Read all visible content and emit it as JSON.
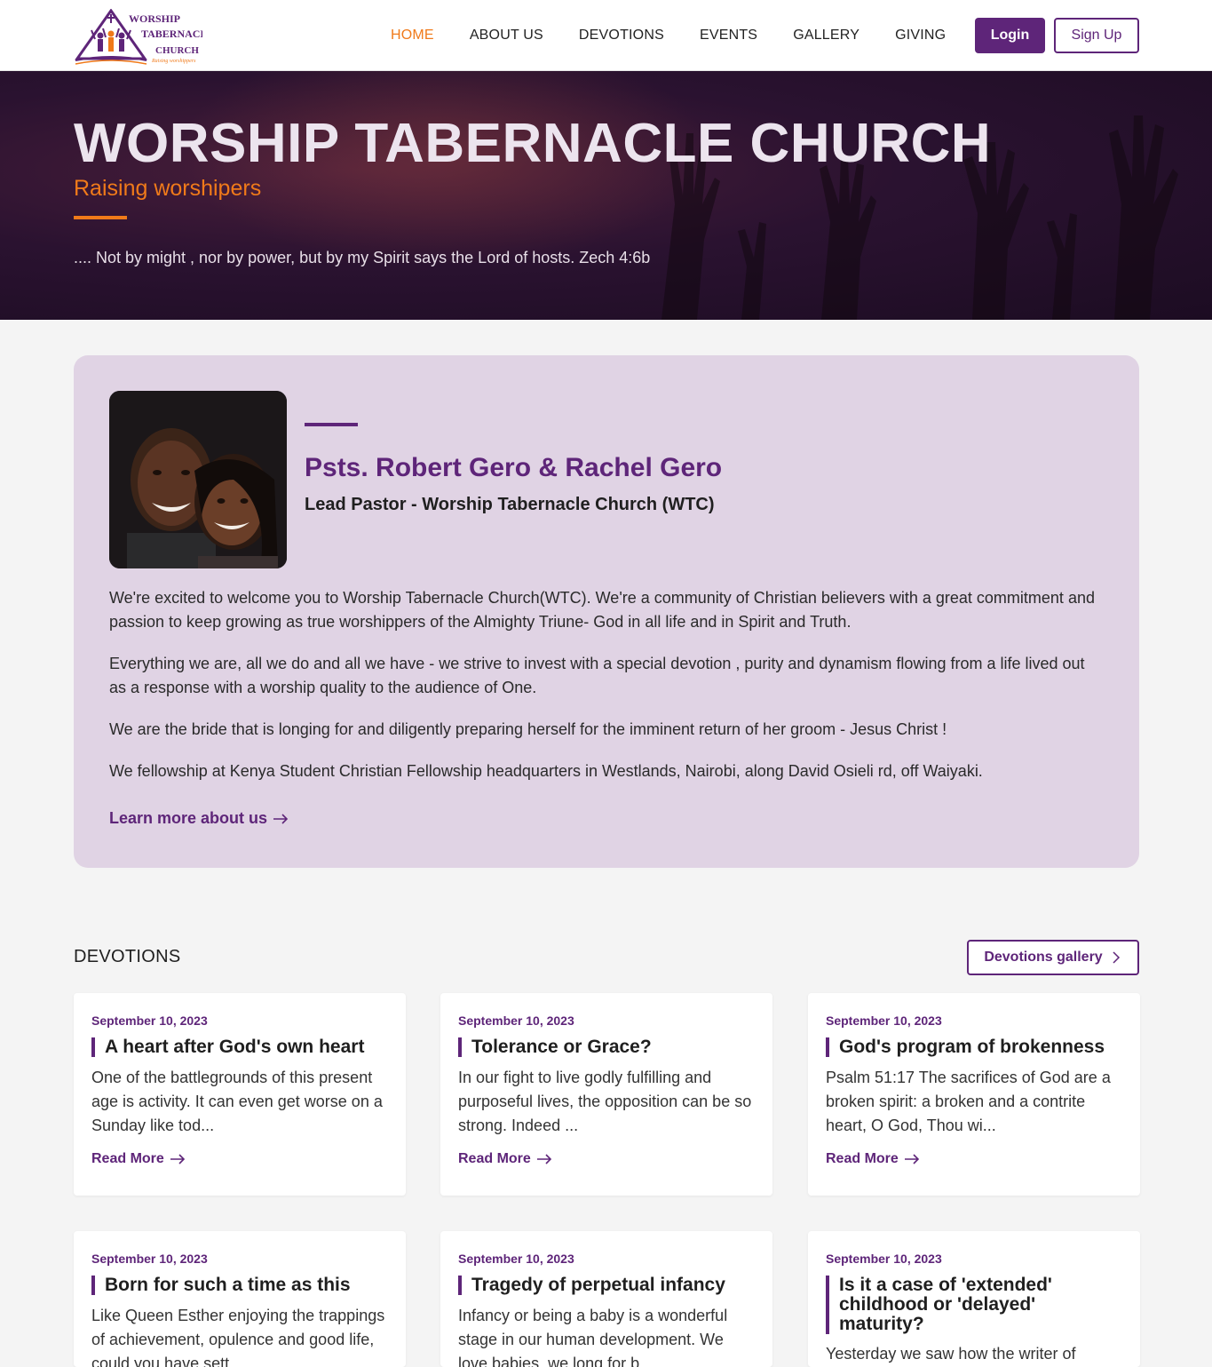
{
  "nav": {
    "logo_lines": [
      "WORSHIP",
      "TABERNACLE",
      "CHURCH"
    ],
    "logo_tagline": "Raising worshippers",
    "links": [
      "HOME",
      "ABOUT US",
      "DEVOTIONS",
      "EVENTS",
      "GALLERY",
      "GIVING"
    ],
    "active": "HOME",
    "login": "Login",
    "signup": "Sign Up"
  },
  "hero": {
    "title": "WORSHIP TABERNACLE CHURCH",
    "subtitle": "Raising worshipers",
    "verse": ".... Not by might , nor by power, but by my Spirit says the Lord of hosts. Zech 4:6b"
  },
  "pastor": {
    "name": "Psts. Robert Gero & Rachel Gero",
    "role": "Lead Pastor - Worship Tabernacle Church (WTC)",
    "paragraphs": [
      "We're excited to welcome you to Worship Tabernacle Church(WTC). We're a community of Christian believers with a great commitment and passion to keep growing as true worshippers of the Almighty Triune- God in all life and in Spirit and Truth.",
      "Everything we are, all we do and all we have - we strive to invest with a special devotion , purity and dynamism flowing from a life lived out as a response with a worship quality to the audience of One.",
      "We are the bride that is longing for and diligently preparing herself for the imminent return of her groom - Jesus Christ !",
      "We fellowship at Kenya Student Christian Fellowship headquarters in Westlands, Nairobi, along David Osieli rd, off Waiyaki."
    ],
    "learn_more": "Learn more about us"
  },
  "devotions": {
    "heading": "DEVOTIONS",
    "gallery_button": "Devotions gallery",
    "read_more": "Read More",
    "items": [
      {
        "date": "September 10, 2023",
        "title": "A heart after God's own heart",
        "excerpt": "One of the battlegrounds of this present age is activity. It can even get worse on a Sunday like tod..."
      },
      {
        "date": "September 10, 2023",
        "title": "Tolerance or Grace?",
        "excerpt": "In our fight to live godly fulfilling and purposeful lives, the opposition can be so strong. Indeed ..."
      },
      {
        "date": "September 10, 2023",
        "title": "God's program of brokenness",
        "excerpt": "Psalm 51:17 The sacrifices of God are a broken spirit: a broken and a contrite heart, O God, Thou wi..."
      },
      {
        "date": "September 10, 2023",
        "title": "Born for such a time as this",
        "excerpt": "Like Queen Esther enjoying the trappings of achievement, opulence and good life, could you have sett..."
      },
      {
        "date": "September 10, 2023",
        "title": "Tragedy of perpetual infancy",
        "excerpt": "Infancy or being a baby is a wonderful stage in our human development. We love babies, we long for b..."
      },
      {
        "date": "September 10, 2023",
        "title": "Is it a case of 'extended' childhood or 'delayed' maturity?",
        "excerpt": "Yesterday we saw how the writer of"
      }
    ]
  },
  "colors": {
    "brand_purple": "#5e2579",
    "accent_orange": "#f07a1a",
    "card_lilac": "#e0d3e4"
  }
}
